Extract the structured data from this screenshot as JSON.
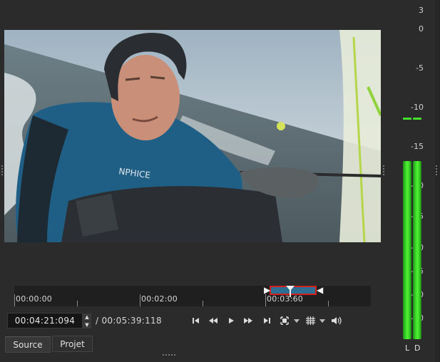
{
  "player": {
    "current_timecode": "00:04:21:094",
    "duration": "/ 00:05:39:118",
    "timeline_labels": [
      "00:00:00",
      "00:02:00",
      "00:03:60"
    ],
    "tabs": [
      "Source",
      "Projet"
    ]
  },
  "audio_meter": {
    "scale": [
      "3",
      "0",
      "-5",
      "-10",
      "-15",
      "-20",
      "-25",
      "-30",
      "-35",
      "-40",
      "-50"
    ],
    "channels": [
      "L",
      "D"
    ],
    "level_color": "#3fdc2a"
  },
  "transport": {
    "icons": [
      "skip-to-start-icon",
      "rewind-icon",
      "play-icon",
      "fast-forward-icon",
      "skip-to-end-icon",
      "zoom-fit-icon",
      "grid-icon",
      "volume-icon"
    ]
  },
  "colors": {
    "background": "#2b2b2b",
    "selection": "#2e6e93",
    "in_out_border": "#d0201c"
  }
}
